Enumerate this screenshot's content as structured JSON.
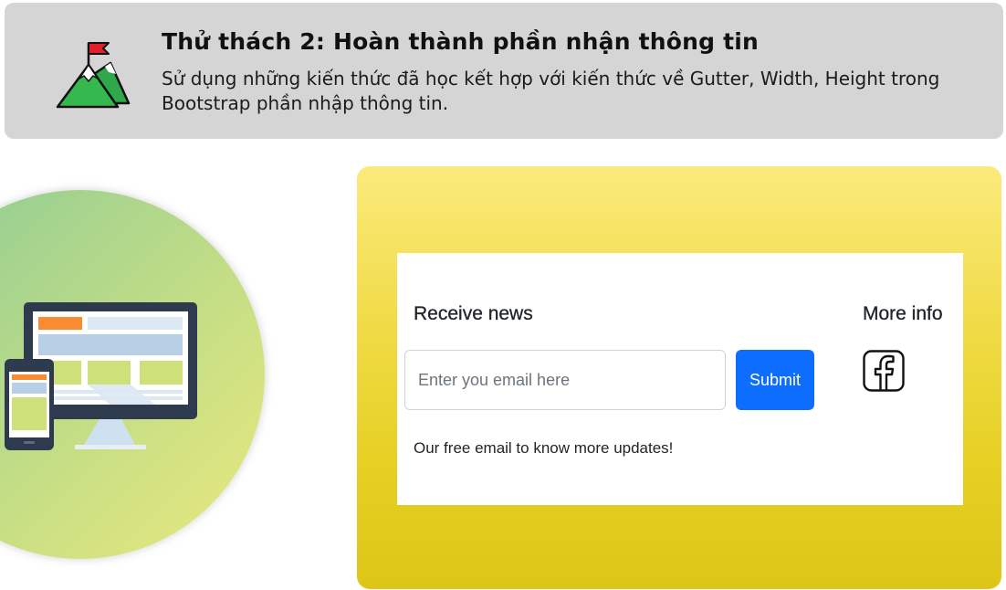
{
  "header": {
    "icon": "mountain-flag-icon",
    "title": "Thử thách 2: Hoàn thành phần nhận thông tin",
    "description": "Sử dụng những kiến thức đã học kết hợp với kiến thức về Gutter, Width, Height trong Bootstrap phần nhập thông tin."
  },
  "illustration": {
    "icon": "responsive-devices-icon"
  },
  "newsletter": {
    "title": "Receive news",
    "email_placeholder": "Enter you email here",
    "submit_label": "Submit",
    "note": "Our free email to know more updates!"
  },
  "more_info": {
    "title": "More info",
    "icon": "facebook-icon"
  },
  "colors": {
    "banner_bg": "#d5d5d5",
    "panel_yellow": "#e6d023",
    "submit_blue": "#0d6efd",
    "circle_green": "#98cf94",
    "circle_yellow": "#e6e87e",
    "device_dark": "#2e3a4d",
    "accent_orange": "#f98b33",
    "flag_red": "#e0202a",
    "mountain_green": "#2fb34a"
  }
}
